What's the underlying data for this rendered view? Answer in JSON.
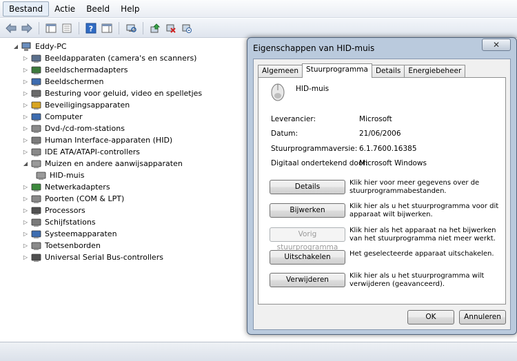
{
  "menu": [
    "Bestand",
    "Actie",
    "Beeld",
    "Help"
  ],
  "toolbar": {
    "icons": [
      "back-arrow-icon",
      "forward-arrow-icon",
      "show-hide-console-tree-icon",
      "properties-icon",
      "help-icon",
      "show-hide-action-pane-icon",
      "scan-hardware-icon",
      "update-driver-icon",
      "disable-device-icon",
      "uninstall-device-icon"
    ]
  },
  "tree": {
    "root": "Eddy-PC",
    "items": [
      {
        "label": "Beeldapparaten (camera's en scanners)",
        "icon": "camera-icon",
        "expanded": false
      },
      {
        "label": "Beeldschermadapters",
        "icon": "display-adapter-icon",
        "expanded": false
      },
      {
        "label": "Beeldschermen",
        "icon": "monitor-icon",
        "expanded": false
      },
      {
        "label": "Besturing voor geluid, video en spelletjes",
        "icon": "sound-icon",
        "expanded": false
      },
      {
        "label": "Beveiligingsapparaten",
        "icon": "security-key-icon",
        "expanded": false
      },
      {
        "label": "Computer",
        "icon": "computer-icon",
        "expanded": false
      },
      {
        "label": "Dvd-/cd-rom-stations",
        "icon": "dvd-drive-icon",
        "expanded": false
      },
      {
        "label": "Human Interface-apparaten (HID)",
        "icon": "hid-icon",
        "expanded": false
      },
      {
        "label": "IDE ATA/ATAPI-controllers",
        "icon": "ide-controller-icon",
        "expanded": false
      },
      {
        "label": "Muizen en andere aanwijsapparaten",
        "icon": "mouse-icon",
        "expanded": true
      },
      {
        "label": "HID-muis",
        "icon": "mouse-icon",
        "child": true
      },
      {
        "label": "Netwerkadapters",
        "icon": "network-adapter-icon",
        "expanded": false
      },
      {
        "label": "Poorten (COM & LPT)",
        "icon": "port-icon",
        "expanded": false
      },
      {
        "label": "Processors",
        "icon": "processor-icon",
        "expanded": false
      },
      {
        "label": "Schijfstations",
        "icon": "disk-drive-icon",
        "expanded": false
      },
      {
        "label": "Systeemapparaten",
        "icon": "system-device-icon",
        "expanded": false
      },
      {
        "label": "Toetsenborden",
        "icon": "keyboard-icon",
        "expanded": false
      },
      {
        "label": "Universal Serial Bus-controllers",
        "icon": "usb-icon",
        "expanded": false
      }
    ]
  },
  "dialog": {
    "title": "Eigenschappen van HID-muis",
    "close_label": "✕",
    "tabs": [
      {
        "label": "Algemeen",
        "active": false
      },
      {
        "label": "Stuurprogramma",
        "active": true
      },
      {
        "label": "Details",
        "active": false
      },
      {
        "label": "Energiebeheer",
        "active": false
      }
    ],
    "device_name": "HID-muis",
    "properties": [
      {
        "label": "Leverancier:",
        "value": "Microsoft"
      },
      {
        "label": "Datum:",
        "value": "21/06/2006"
      },
      {
        "label": "Stuurprogrammaversie:",
        "value": "6.1.7600.16385"
      },
      {
        "label": "Digitaal ondertekend door:",
        "value": "Microsoft Windows"
      }
    ],
    "actions": [
      {
        "label": "Details",
        "desc": "Klik hier voor meer gegevens over de stuurprogrammabestanden.",
        "disabled": false
      },
      {
        "label": "Bijwerken",
        "desc": "Klik hier als u het stuurprogramma voor dit apparaat wilt bijwerken.",
        "disabled": false
      },
      {
        "label": "Vorig stuurprogramma",
        "desc": "Klik hier als het apparaat na het bijwerken van het stuurprogramma niet meer werkt.",
        "disabled": true
      },
      {
        "label": "Uitschakelen",
        "desc": "Het geselecteerde apparaat uitschakelen.",
        "disabled": false
      },
      {
        "label": "Verwijderen",
        "desc": "Klik hier als u het stuurprogramma wilt verwijderen (geavanceerd).",
        "disabled": false
      }
    ],
    "ok_label": "OK",
    "cancel_label": "Annuleren"
  }
}
